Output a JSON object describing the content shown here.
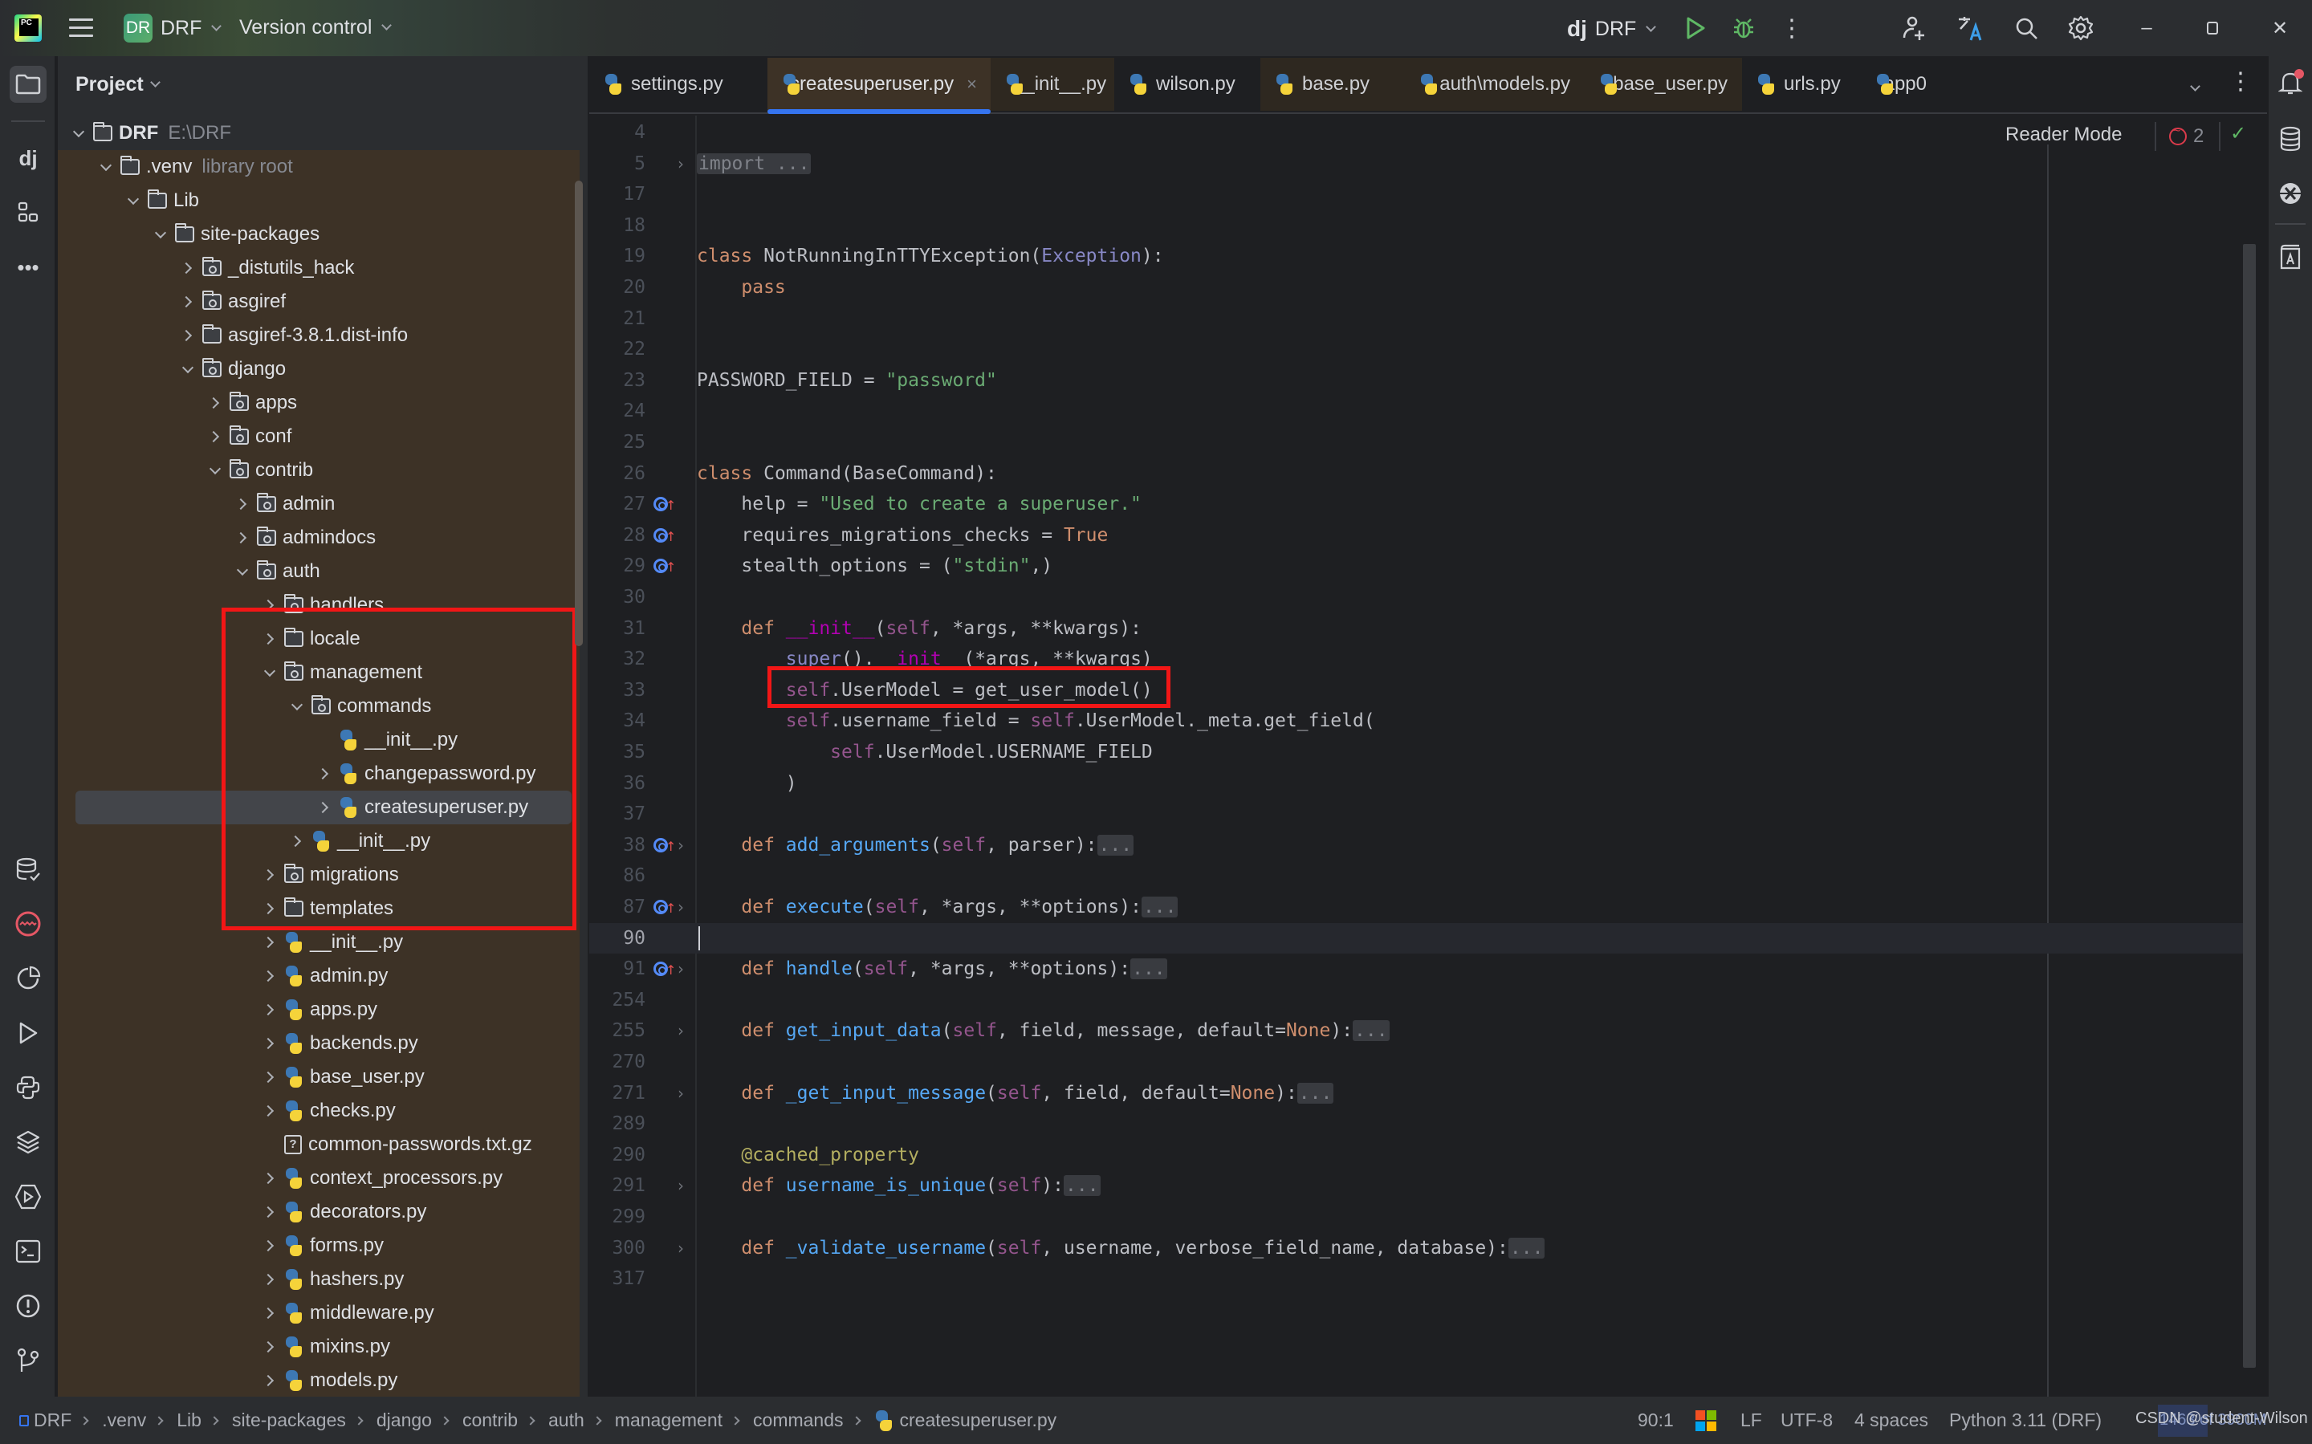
{
  "titlebar": {
    "app_icon": "pycharm-logo",
    "project_badge": "DR",
    "project_name": "DRF",
    "vcs_label": "Version control",
    "run_config_icon": "django-icon",
    "run_config_prefix": "dj",
    "run_config": "DRF",
    "icons": [
      "menu-icon",
      "run-icon",
      "debug-icon",
      "more-vert-icon",
      "add-user-icon",
      "translate-icon",
      "search-icon",
      "settings-icon",
      "minimize-icon",
      "restore-icon",
      "close-icon"
    ]
  },
  "left_strip": {
    "top_icons": [
      "project-folder-icon",
      "django-structure-icon",
      "structure-icon",
      "more-icon"
    ],
    "bottom_icons": [
      "database-check-icon",
      "problems-red-icon",
      "profiler-icon",
      "run-icon",
      "python-console-icon",
      "layers-icon",
      "services-icon",
      "terminal-icon",
      "problems-icon",
      "git-icon"
    ]
  },
  "project_panel": {
    "title": "Project",
    "tree": [
      {
        "label": "DRF",
        "sub": "E:\\DRF",
        "depth": 0,
        "expander": "open",
        "icon": "folder",
        "bold": true
      },
      {
        "label": ".venv",
        "sub": "library root",
        "depth": 1,
        "expander": "open",
        "icon": "folder"
      },
      {
        "label": "Lib",
        "depth": 2,
        "expander": "open",
        "icon": "folder"
      },
      {
        "label": "site-packages",
        "depth": 3,
        "expander": "open",
        "icon": "folder"
      },
      {
        "label": "_distutils_hack",
        "depth": 4,
        "expander": "closed",
        "icon": "package"
      },
      {
        "label": "asgiref",
        "depth": 4,
        "expander": "closed",
        "icon": "package"
      },
      {
        "label": "asgiref-3.8.1.dist-info",
        "depth": 4,
        "expander": "closed",
        "icon": "folder"
      },
      {
        "label": "django",
        "depth": 4,
        "expander": "open",
        "icon": "package"
      },
      {
        "label": "apps",
        "depth": 5,
        "expander": "closed",
        "icon": "package"
      },
      {
        "label": "conf",
        "depth": 5,
        "expander": "closed",
        "icon": "package"
      },
      {
        "label": "contrib",
        "depth": 5,
        "expander": "open",
        "icon": "package"
      },
      {
        "label": "admin",
        "depth": 6,
        "expander": "closed",
        "icon": "package"
      },
      {
        "label": "admindocs",
        "depth": 6,
        "expander": "closed",
        "icon": "package"
      },
      {
        "label": "auth",
        "depth": 6,
        "expander": "open",
        "icon": "package"
      },
      {
        "label": "handlers",
        "depth": 7,
        "expander": "closed",
        "icon": "package"
      },
      {
        "label": "locale",
        "depth": 7,
        "expander": "closed",
        "icon": "folder"
      },
      {
        "label": "management",
        "depth": 7,
        "expander": "open",
        "icon": "package"
      },
      {
        "label": "commands",
        "depth": 8,
        "expander": "open",
        "icon": "package"
      },
      {
        "label": "__init__.py",
        "depth": 9,
        "expander": "none",
        "icon": "python"
      },
      {
        "label": "changepassword.py",
        "depth": 9,
        "expander": "closed",
        "icon": "python"
      },
      {
        "label": "createsuperuser.py",
        "depth": 9,
        "expander": "closed",
        "icon": "python",
        "selected": true
      },
      {
        "label": "__init__.py",
        "depth": 8,
        "expander": "closed",
        "icon": "python"
      },
      {
        "label": "migrations",
        "depth": 7,
        "expander": "closed",
        "icon": "package"
      },
      {
        "label": "templates",
        "depth": 7,
        "expander": "closed",
        "icon": "folder"
      },
      {
        "label": "__init__.py",
        "depth": 7,
        "expander": "closed",
        "icon": "python"
      },
      {
        "label": "admin.py",
        "depth": 7,
        "expander": "closed",
        "icon": "python"
      },
      {
        "label": "apps.py",
        "depth": 7,
        "expander": "closed",
        "icon": "python"
      },
      {
        "label": "backends.py",
        "depth": 7,
        "expander": "closed",
        "icon": "python"
      },
      {
        "label": "base_user.py",
        "depth": 7,
        "expander": "closed",
        "icon": "python"
      },
      {
        "label": "checks.py",
        "depth": 7,
        "expander": "closed",
        "icon": "python"
      },
      {
        "label": "common-passwords.txt.gz",
        "depth": 7,
        "expander": "none",
        "icon": "unknown"
      },
      {
        "label": "context_processors.py",
        "depth": 7,
        "expander": "closed",
        "icon": "python"
      },
      {
        "label": "decorators.py",
        "depth": 7,
        "expander": "closed",
        "icon": "python"
      },
      {
        "label": "forms.py",
        "depth": 7,
        "expander": "closed",
        "icon": "python"
      },
      {
        "label": "hashers.py",
        "depth": 7,
        "expander": "closed",
        "icon": "python"
      },
      {
        "label": "middleware.py",
        "depth": 7,
        "expander": "closed",
        "icon": "python"
      },
      {
        "label": "mixins.py",
        "depth": 7,
        "expander": "closed",
        "icon": "python"
      },
      {
        "label": "models.py",
        "depth": 7,
        "expander": "closed",
        "icon": "python"
      }
    ]
  },
  "tabs": [
    {
      "label": "settings.py",
      "style": "plain"
    },
    {
      "label": "createsuperuser.py",
      "style": "active",
      "closable": true
    },
    {
      "label": "__init__.py",
      "style": "brown"
    },
    {
      "label": "wilson.py",
      "style": "plain"
    },
    {
      "label": "base.py",
      "style": "brown"
    },
    {
      "label": "auth\\models.py",
      "style": "brown"
    },
    {
      "label": "base_user.py",
      "style": "brown"
    },
    {
      "label": "urls.py",
      "style": "plain"
    },
    {
      "label": "app0",
      "style": "plain"
    }
  ],
  "tab_close_glyph": "×",
  "editor": {
    "reader_mode_label": "Reader Mode",
    "problem_count": "2",
    "lines": [
      {
        "n": "4",
        "html": ""
      },
      {
        "n": "5",
        "fold": true,
        "html": "<span class=\"fold-box\">import ...</span>"
      },
      {
        "n": "17",
        "html": ""
      },
      {
        "n": "18",
        "html": ""
      },
      {
        "n": "19",
        "html": "<span class=\"k\">class</span> NotRunningInTTYException(<span class=\"bi\">Exception</span>):"
      },
      {
        "n": "20",
        "html": "    <span class=\"k\">pass</span>"
      },
      {
        "n": "21",
        "html": ""
      },
      {
        "n": "22",
        "html": ""
      },
      {
        "n": "23",
        "html": "PASSWORD_FIELD = <span class=\"s\">\"password\"</span>"
      },
      {
        "n": "24",
        "html": ""
      },
      {
        "n": "25",
        "html": ""
      },
      {
        "n": "26",
        "html": "<span class=\"k\">class</span> Command(BaseCommand):"
      },
      {
        "n": "27",
        "override": true,
        "html": "    help = <span class=\"s\">\"Used to create a superuser.\"</span>"
      },
      {
        "n": "28",
        "override": true,
        "html": "    requires_migrations_checks = <span class=\"k\">True</span>"
      },
      {
        "n": "29",
        "override": true,
        "html": "    stealth_options = (<span class=\"s\">\"stdin\"</span>,)"
      },
      {
        "n": "30",
        "html": ""
      },
      {
        "n": "31",
        "html": "    <span class=\"k\">def</span> <span class=\"dunder\">__init__</span>(<span class=\"slf\">self</span>, *args, **kwargs):"
      },
      {
        "n": "32",
        "html": "        <span class=\"bi underl\">super</span>().<span class=\"dunder underl\">__init__</span>(*args, **kwargs)"
      },
      {
        "n": "33",
        "html": "        <span class=\"slf\">self</span>.UserModel = get_user_model()"
      },
      {
        "n": "34",
        "html": "        <span class=\"slf\">self</span>.username_field = <span class=\"slf\">self</span>.UserModel._meta.get_field("
      },
      {
        "n": "35",
        "html": "            <span class=\"slf\">self</span>.UserModel.USERNAME_FIELD"
      },
      {
        "n": "36",
        "html": "        )"
      },
      {
        "n": "37",
        "html": ""
      },
      {
        "n": "38",
        "override": true,
        "fold": true,
        "html": "    <span class=\"k\">def</span> <span class=\"fn\">add_arguments</span>(<span class=\"slf\">self</span>, parser):<span class=\"fold-box\">...</span>"
      },
      {
        "n": "86",
        "html": ""
      },
      {
        "n": "87",
        "override": true,
        "fold": true,
        "html": "    <span class=\"k\">def</span> <span class=\"fn\">execute</span>(<span class=\"slf\">self</span>, *args, **options):<span class=\"fold-box\">...</span>"
      },
      {
        "n": "90",
        "current": true,
        "html": ""
      },
      {
        "n": "91",
        "override": true,
        "fold": true,
        "html": "    <span class=\"k\">def</span> <span class=\"fn\">handle</span>(<span class=\"slf\">self</span>, *args, **options):<span class=\"fold-box\">...</span>"
      },
      {
        "n": "254",
        "html": ""
      },
      {
        "n": "255",
        "fold": true,
        "html": "    <span class=\"k\">def</span> <span class=\"fn\">get_input_data</span>(<span class=\"slf\">self</span>, field, message, default=<span class=\"k\">None</span>):<span class=\"fold-box\">...</span>"
      },
      {
        "n": "270",
        "html": ""
      },
      {
        "n": "271",
        "fold": true,
        "html": "    <span class=\"k\">def</span> <span class=\"fn\">_get_input_message</span>(<span class=\"slf\">self</span>, field, default=<span class=\"k\">None</span>):<span class=\"fold-box\">...</span>"
      },
      {
        "n": "289",
        "html": ""
      },
      {
        "n": "290",
        "html": "    <span class=\"deco\">@cached_property</span>"
      },
      {
        "n": "291",
        "fold": true,
        "html": "    <span class=\"k\">def</span> <span class=\"fn\">username_is_unique</span>(<span class=\"slf\">self</span>):<span class=\"fold-box\">...</span>"
      },
      {
        "n": "299",
        "html": ""
      },
      {
        "n": "300",
        "fold": true,
        "html": "    <span class=\"k\">def</span> <span class=\"fn\">_validate_username</span>(<span class=\"slf\">self</span>, username, verbose_field_name, database):<span class=\"fold-box\">...</span>"
      },
      {
        "n": "317",
        "html": ""
      }
    ]
  },
  "right_strip": {
    "icons": [
      "notifications-icon",
      "database-icon",
      "ai-assistant-icon",
      "dictionary-icon"
    ]
  },
  "statusbar": {
    "breadcrumbs": [
      "DRF",
      ".venv",
      "Lib",
      "site-packages",
      "django",
      "contrib",
      "auth",
      "management",
      "commands",
      "createsuperuser.py"
    ],
    "caret_position": "90:1",
    "line_separator": "LF",
    "encoding": "UTF-8",
    "indent": "4 spaces",
    "interpreter": "Python 3.11 (DRF)",
    "memory": "1463 of 3900M",
    "watermark": "CSDN @student-Wilson"
  },
  "colors": {
    "accent": "#3574f0",
    "highlight_box": "#f21616",
    "library_bg": "#3d3226",
    "editor_bg": "#1e1f22"
  }
}
